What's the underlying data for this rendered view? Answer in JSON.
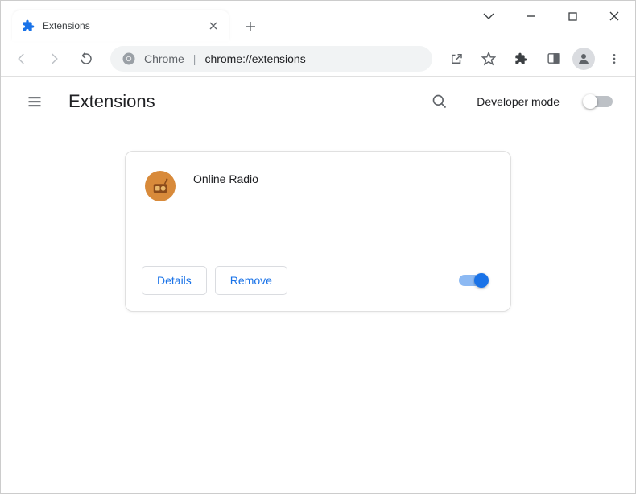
{
  "window": {
    "tab_title": "Extensions"
  },
  "toolbar": {
    "omnibox_prefix": "Chrome",
    "omnibox_url": "chrome://extensions"
  },
  "page": {
    "title": "Extensions",
    "developer_mode_label": "Developer mode",
    "developer_mode_on": false
  },
  "extension": {
    "name": "Online Radio",
    "details_label": "Details",
    "remove_label": "Remove",
    "enabled": true
  }
}
